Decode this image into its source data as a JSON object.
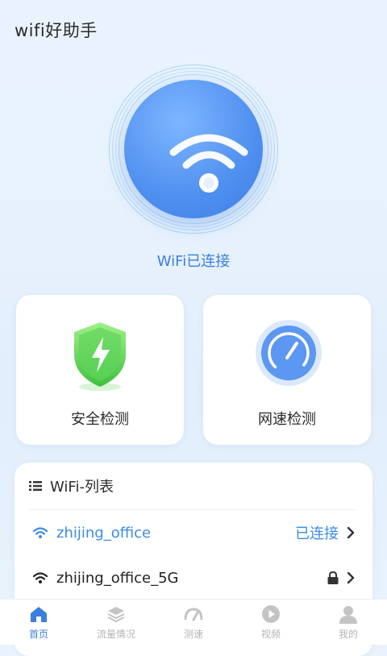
{
  "app": {
    "title": "wifi好助手"
  },
  "hero": {
    "status": "WiFi已连接"
  },
  "cards": {
    "security": {
      "label": "安全检测"
    },
    "speed": {
      "label": "网速检测"
    }
  },
  "wifi_list": {
    "title": "WiFi-列表",
    "networks": [
      {
        "ssid": "zhijing_office",
        "status": "已连接"
      },
      {
        "ssid": "zhijing_office_5G",
        "status": ""
      }
    ]
  },
  "nav": {
    "items": [
      {
        "label": "首页",
        "icon": "home-icon"
      },
      {
        "label": "流量情况",
        "icon": "layers-icon"
      },
      {
        "label": "测速",
        "icon": "speedometer-icon"
      },
      {
        "label": "视频",
        "icon": "play-icon"
      },
      {
        "label": "我的",
        "icon": "user-icon"
      }
    ]
  },
  "colors": {
    "accent": "#3b7fe0",
    "connected": "#3b8be6",
    "shield": "#5fd45a"
  }
}
